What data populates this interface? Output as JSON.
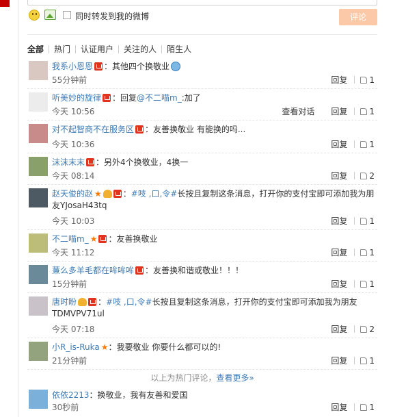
{
  "composer": {
    "emoji_icon": "smiley-icon",
    "image_icon": "image-icon",
    "repost_label": "同时转发到我的微博",
    "repost_checked": false,
    "submit_label": "评论"
  },
  "filters": [
    "全部",
    "热门",
    "认证用户",
    "关注的人",
    "陌生人"
  ],
  "comments": [
    {
      "user": "我系小恩恩",
      "badges": [
        "vip"
      ],
      "text": "：其他四个换敬业",
      "text_tail": "",
      "time": "55分钟前",
      "likes": "1",
      "extra_action": ""
    },
    {
      "user": "听美妙的旋律",
      "badges": [
        "vip"
      ],
      "text": "：回复",
      "mention": "@不二喵m_",
      "text_tail": ":加了",
      "time": "今天 10:56",
      "likes": "1",
      "extra_action": "查看对话"
    },
    {
      "user": "对不起智商不在服务区",
      "badges": [
        "vip"
      ],
      "text": "：友善换敬业 有能换的吗...",
      "text_tail": "",
      "time": "今天 10:36",
      "likes": "1",
      "extra_action": ""
    },
    {
      "user": "沫沫末末",
      "badges": [
        "vip"
      ],
      "text": "：另外4个换敬业，4换一",
      "text_tail": "",
      "time": "今天 08:14",
      "likes": "2",
      "extra_action": ""
    },
    {
      "user": "赵天俊的赵",
      "badges": [
        "star",
        "crown",
        "vip"
      ],
      "text": "：",
      "topic": "#吱 ,口,令#",
      "text_tail": "长按且复制这条消息，打开你的支付宝即可添加我为朋友YJosaH43tq",
      "time": "今天 10:03",
      "likes": "1",
      "extra_action": ""
    },
    {
      "user": "不二喵m_",
      "badges": [
        "star",
        "vip"
      ],
      "text": "：友善换敬业",
      "text_tail": "",
      "time": "今天 11:12",
      "likes": "1",
      "extra_action": ""
    },
    {
      "user": "蒹么多羊毛都在哞哞哞",
      "badges": [
        "vip"
      ],
      "text": "：友善换和谐或敬业！！！",
      "text_tail": "",
      "time": "15分钟前",
      "likes": "1",
      "extra_action": ""
    },
    {
      "user": "唐时盼",
      "badges": [
        "crown",
        "vip"
      ],
      "text": "：",
      "topic": "#吱 ,口,令#",
      "text_tail": "长按且复制这条消息，打开你的支付宝即可添加我为朋友TDMVPV71ul",
      "time": "今天 07:18",
      "likes": "2",
      "extra_action": ""
    },
    {
      "user": "小R_is-Ruka",
      "badges": [
        "star"
      ],
      "text": "：我要敬业 你要什么都可以的!",
      "text_tail": "",
      "time": "21分钟前",
      "likes": "1",
      "extra_action": ""
    }
  ],
  "hot_end": {
    "text": "以上为热门评论，",
    "more": "查看更多»"
  },
  "latest": {
    "user": "依依2213",
    "text": "：换敬业，我有友善和爱国",
    "time": "30秒前",
    "likes": "1"
  },
  "labels": {
    "reply": "回复"
  },
  "colors": {
    "link": "#3e7bb6",
    "submit_bg": "#fbc8a8",
    "vip": "#e0341e"
  }
}
